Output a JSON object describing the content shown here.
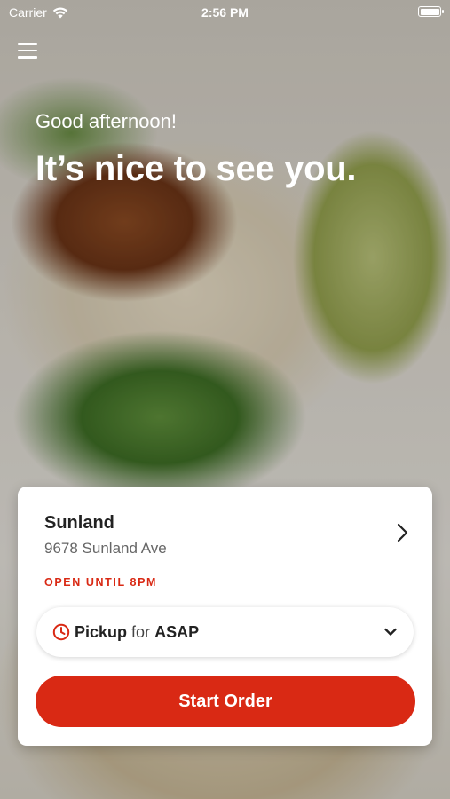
{
  "status_bar": {
    "carrier": "Carrier",
    "time": "2:56 PM",
    "wifi_icon": "wifi-icon",
    "battery_icon": "battery-icon"
  },
  "header": {
    "menu_icon": "hamburger-menu-icon"
  },
  "hero": {
    "greeting": "Good afternoon!",
    "headline": "It’s nice to see you."
  },
  "location_card": {
    "store_name": "Sunland",
    "store_address": "9678 Sunland Ave",
    "open_status": "OPEN UNTIL 8PM",
    "pickup": {
      "mode": "Pickup",
      "connector": "for",
      "time": "ASAP"
    },
    "start_order_label": "Start Order"
  },
  "colors": {
    "accent": "#d92914",
    "card_bg": "#ffffff",
    "text_dark": "#222222",
    "text_muted": "#666666"
  }
}
